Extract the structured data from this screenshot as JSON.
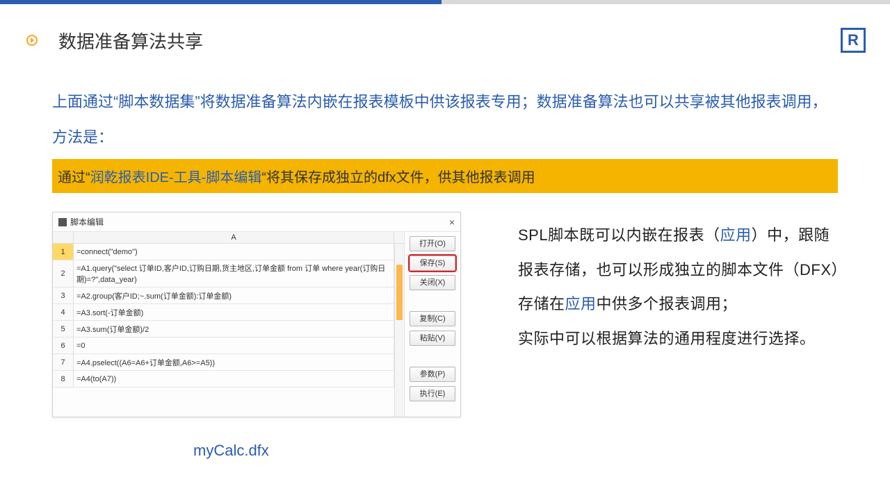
{
  "header": {
    "title": "数据准备算法共享",
    "logo_letter": "R"
  },
  "intro": {
    "text": "上面通过“脚本数据集”将数据准备算法内嵌在报表模板中供该报表专用；数据准备算法也可以共享被其他报表调用，方法是："
  },
  "banner": {
    "pre": "通过“",
    "hl": "润乾报表IDE-工具-脚本编辑",
    "post": "“将其保存成独立的dfx文件，供其他报表调用"
  },
  "editor": {
    "title": "脚本编辑",
    "close": "×",
    "column_header": "A",
    "rows": [
      {
        "n": "1",
        "v": "=connect(\"demo\")"
      },
      {
        "n": "2",
        "v": "=A1.query(\"select 订单ID,客户ID,订购日期,货主地区,订单金额 from 订单 where year(订购日期)=?\",data_year)"
      },
      {
        "n": "3",
        "v": "=A2.group(客户ID;~.sum(订单金额):订单金额)"
      },
      {
        "n": "4",
        "v": "=A3.sort(-订单金额)"
      },
      {
        "n": "5",
        "v": "=A3.sum(订单金额)/2"
      },
      {
        "n": "6",
        "v": "=0"
      },
      {
        "n": "7",
        "v": "=A4.pselect((A6=A6+订单金额,A6>=A5))"
      },
      {
        "n": "8",
        "v": "=A4(to(A7))"
      }
    ],
    "buttons": {
      "open": "打开(O)",
      "save": "保存(S)",
      "close_btn": "关闭(X)",
      "copy": "复制(C)",
      "paste": "粘贴(V)",
      "params": "参数(P)",
      "run": "执行(E)"
    }
  },
  "caption": "myCalc.dfx",
  "right_col": {
    "p1a": "SPL脚本既可以内嵌在报表（",
    "p1link1": "应用",
    "p1b": "）中，跟随报表存储，也可以形成独立的脚本文件（DFX）存储在",
    "p1link2": "应用",
    "p1c": "中供多个报表调用；",
    "p2": "实际中可以根据算法的通用程度进行选择。"
  }
}
